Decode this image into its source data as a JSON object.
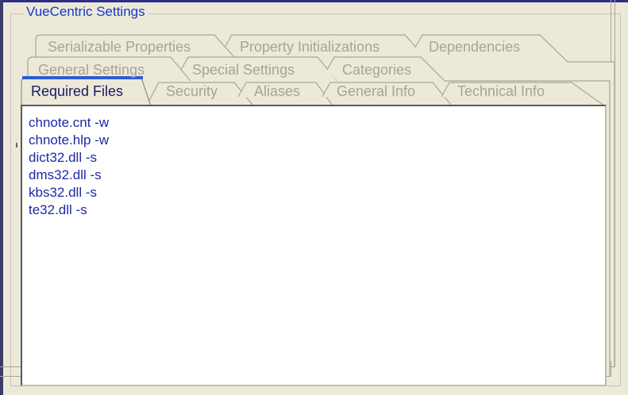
{
  "groupbox": {
    "title": "VueCentric Settings"
  },
  "tabs": {
    "row3": [
      {
        "label": "Serializable Properties"
      },
      {
        "label": "Property Initializations"
      },
      {
        "label": "Dependencies"
      }
    ],
    "row2": [
      {
        "label": "General Settings"
      },
      {
        "label": "Special Settings"
      },
      {
        "label": "Categories"
      }
    ],
    "row1": [
      {
        "label": "Required Files",
        "active": true
      },
      {
        "label": "Security"
      },
      {
        "label": "Aliases"
      },
      {
        "label": "General Info"
      },
      {
        "label": "Technical Info"
      }
    ]
  },
  "required_files": [
    "chnote.cnt -w",
    "chnote.hlp -w",
    "dict32.dll -s",
    "dms32.dll -s",
    "kbs32.dll -s",
    "te32.dll -s"
  ],
  "colors": {
    "accent": "#1538cc",
    "file_text": "#1b2aa6",
    "inactive_tab_text": "#a7a498",
    "background": "#ece9d8",
    "active_tab_indicator": "#2f5bd6"
  }
}
